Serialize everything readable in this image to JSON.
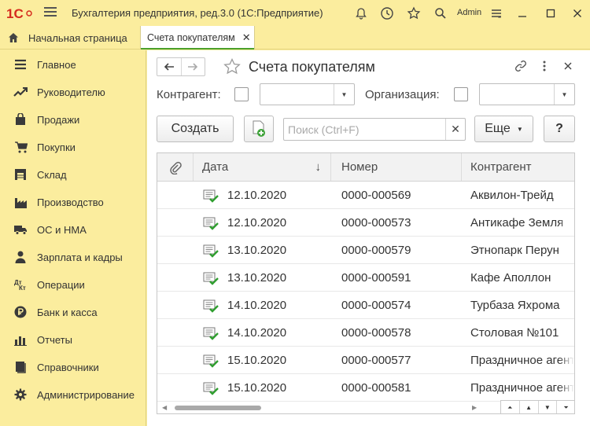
{
  "app": {
    "logo": "1С",
    "title": "Бухгалтерия предприятия, ред.3.0  (1С:Предприятие)",
    "user": "Admin"
  },
  "tabs": {
    "home_label": "Начальная страница",
    "active_label": "Счета покупателям"
  },
  "sidebar": {
    "items": [
      {
        "label": "Главное",
        "icon": "menu-lines-icon"
      },
      {
        "label": "Руководителю",
        "icon": "trend-icon"
      },
      {
        "label": "Продажи",
        "icon": "shopping-bag-icon"
      },
      {
        "label": "Покупки",
        "icon": "cart-icon"
      },
      {
        "label": "Склад",
        "icon": "warehouse-icon"
      },
      {
        "label": "Производство",
        "icon": "factory-icon"
      },
      {
        "label": "ОС и НМА",
        "icon": "truck-icon"
      },
      {
        "label": "Зарплата и кадры",
        "icon": "person-icon"
      },
      {
        "label": "Операции",
        "icon": "debit-credit-icon"
      },
      {
        "label": "Банк и касса",
        "icon": "ruble-coin-icon"
      },
      {
        "label": "Отчеты",
        "icon": "bar-chart-icon"
      },
      {
        "label": "Справочники",
        "icon": "books-icon"
      },
      {
        "label": "Администрирование",
        "icon": "gear-icon"
      }
    ]
  },
  "form": {
    "title": "Счета покупателям",
    "filter_counterparty_label": "Контрагент:",
    "filter_org_label": "Организация:",
    "counterparty_value": "",
    "org_value": "",
    "create_label": "Создать",
    "search_placeholder": "Поиск (Ctrl+F)",
    "more_label": "Еще",
    "help_label": "?"
  },
  "table": {
    "columns": [
      "Дата",
      "Номер",
      "Контрагент"
    ],
    "rows": [
      {
        "date": "12.10.2020",
        "number": "0000-000569",
        "counterparty": "Аквилон-Трейд"
      },
      {
        "date": "12.10.2020",
        "number": "0000-000573",
        "counterparty": "Антикафе Земля"
      },
      {
        "date": "13.10.2020",
        "number": "0000-000579",
        "counterparty": "Этнопарк Перун"
      },
      {
        "date": "13.10.2020",
        "number": "0000-000591",
        "counterparty": "Кафе Аполлон"
      },
      {
        "date": "14.10.2020",
        "number": "0000-000574",
        "counterparty": "Турбаза Яхрома"
      },
      {
        "date": "14.10.2020",
        "number": "0000-000578",
        "counterparty": "Столовая №101"
      },
      {
        "date": "15.10.2020",
        "number": "0000-000577",
        "counterparty": "Праздничное агентство"
      },
      {
        "date": "15.10.2020",
        "number": "0000-000581",
        "counterparty": "Праздничное агентство"
      }
    ]
  },
  "colors": {
    "chrome": "#fbed9e",
    "accent_green": "#4ba02c",
    "logo_red": "#d52b1e"
  }
}
